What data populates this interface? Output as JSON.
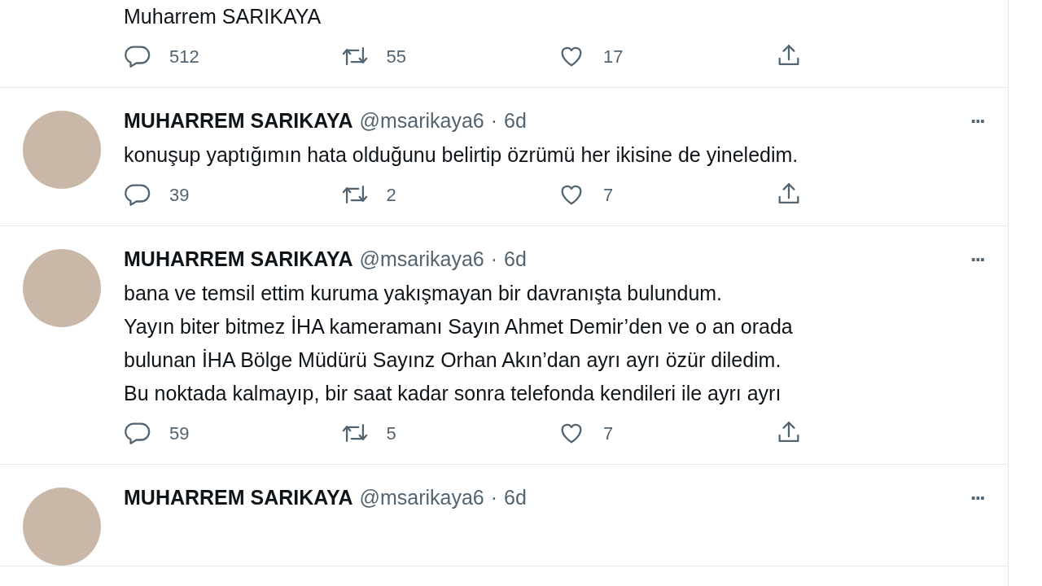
{
  "tweets": [
    {
      "text": [
        "Muharrem SARIKAYA"
      ],
      "replies": "512",
      "retweets": "55",
      "likes": "17"
    },
    {
      "name": "MUHARREM SARIKAYA",
      "handle": "@msarikaya6",
      "sep": "·",
      "time": "6d",
      "more": "···",
      "text": [
        "konuşup yaptığımın hata olduğunu belirtip özrümü her ikisine de yineledim."
      ],
      "replies": "39",
      "retweets": "2",
      "likes": "7"
    },
    {
      "name": "MUHARREM SARIKAYA",
      "handle": "@msarikaya6",
      "sep": "·",
      "time": "6d",
      "more": "···",
      "text": [
        "bana ve temsil ettim kuruma yakışmayan bir davranışta bulundum.",
        "Yayın biter bitmez İHA kameramanı Sayın Ahmet Demir’den ve o an orada",
        "bulunan İHA Bölge Müdürü Sayınz Orhan Akın’dan ayrı ayrı özür diledim.",
        "Bu noktada kalmayıp, bir saat kadar sonra telefonda kendileri ile ayrı ayrı"
      ],
      "replies": "59",
      "retweets": "5",
      "likes": "7"
    },
    {
      "name": "MUHARREM SARIKAYA",
      "handle": "@msarikaya6",
      "sep": "·",
      "time": "6d",
      "more": "···"
    }
  ]
}
